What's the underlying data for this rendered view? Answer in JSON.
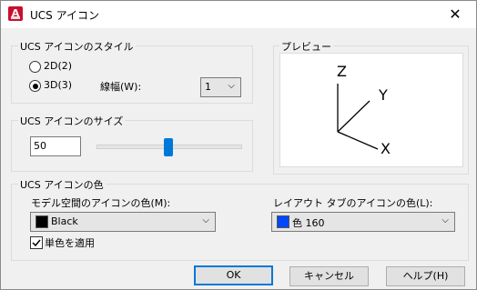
{
  "window": {
    "title": "UCS アイコン",
    "app_icon_letter": "A",
    "close_glyph": "✕"
  },
  "style_group": {
    "label": "UCS アイコンのスタイル",
    "radio_2d": "2D(2)",
    "radio_3d": "3D(3)",
    "selected": "3D",
    "line_width_label": "線幅(W):",
    "line_width_value": "1"
  },
  "preview": {
    "label": "プレビュー",
    "axes": {
      "z": "Z",
      "y": "Y",
      "x": "X"
    }
  },
  "size_group": {
    "label": "UCS アイコンのサイズ",
    "value": "50",
    "slider_fraction": 0.5
  },
  "color_group": {
    "label": "UCS アイコンの色",
    "model_label": "モデル空間のアイコンの色(M):",
    "model_color_name": "Black",
    "model_swatch": "#000000",
    "layout_label": "レイアウト タブのアイコンの色(L):",
    "layout_color_name": "色 160",
    "layout_swatch": "#0048ff",
    "single_color_label": "単色を適用",
    "single_color_checked": true
  },
  "buttons": {
    "ok": "OK",
    "cancel": "キャンセル",
    "help": "ヘルプ(H)"
  },
  "colors": {
    "accent": "#0078d7",
    "app_icon": "#c8102e"
  }
}
